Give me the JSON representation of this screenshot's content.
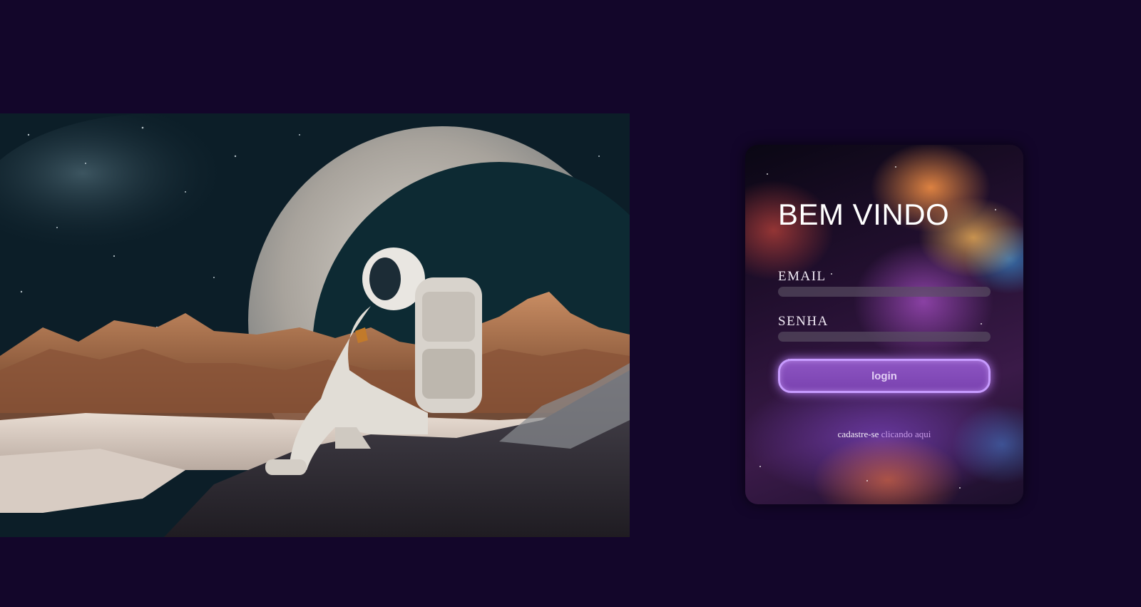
{
  "hero": {
    "image_subject": "astronaut-moon-illustration"
  },
  "login": {
    "title": "BEM VINDO",
    "email_label": "EMAIL",
    "email_value": "",
    "password_label": "SENHA",
    "password_value": "",
    "button_label": "login",
    "signup_prefix": "cadastre-se",
    "signup_link": "clicando aqui"
  },
  "colors": {
    "page_background": "#13062a",
    "button_fill": "#8d55c2",
    "button_glow": "#c79bff",
    "link": "#c89be8"
  }
}
